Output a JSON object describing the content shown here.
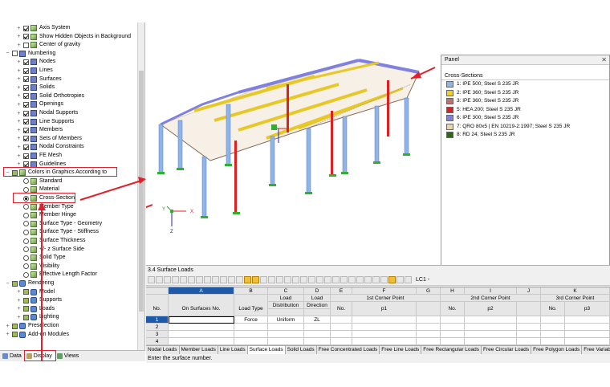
{
  "tree": {
    "items": [
      {
        "label": "Axis System",
        "kind": "check",
        "state": "on",
        "icon": "axis-icon"
      },
      {
        "label": "Show Hidden Objects in Background",
        "kind": "check",
        "state": "on",
        "icon": "hidden-objects-icon"
      },
      {
        "label": "Center of gravity",
        "kind": "check",
        "state": "off",
        "icon": "center-of-gravity-icon"
      },
      {
        "label": "Numbering",
        "kind": "check",
        "state": "off",
        "icon": "numbering-icon"
      },
      {
        "label": "Nodes",
        "kind": "check",
        "state": "on",
        "icon": "numbering-icon"
      },
      {
        "label": "Lines",
        "kind": "check",
        "state": "on",
        "icon": "numbering-icon"
      },
      {
        "label": "Surfaces",
        "kind": "check",
        "state": "on",
        "icon": "numbering-icon"
      },
      {
        "label": "Solids",
        "kind": "check",
        "state": "on",
        "icon": "numbering-icon"
      },
      {
        "label": "Solid Orthotropies",
        "kind": "check",
        "state": "on",
        "icon": "numbering-icon"
      },
      {
        "label": "Openings",
        "kind": "check",
        "state": "on",
        "icon": "numbering-icon"
      },
      {
        "label": "Nodal Supports",
        "kind": "check",
        "state": "on",
        "icon": "numbering-icon"
      },
      {
        "label": "Line Supports",
        "kind": "check",
        "state": "on",
        "icon": "numbering-icon"
      },
      {
        "label": "Members",
        "kind": "check",
        "state": "on",
        "icon": "numbering-icon"
      },
      {
        "label": "Sets of Members",
        "kind": "check",
        "state": "on",
        "icon": "numbering-icon"
      },
      {
        "label": "Nodal Constraints",
        "kind": "check",
        "state": "on",
        "icon": "numbering-icon"
      },
      {
        "label": "FE Mesh",
        "kind": "check",
        "state": "on",
        "icon": "numbering-icon"
      },
      {
        "label": "Guidelines",
        "kind": "check",
        "state": "on",
        "icon": "numbering-icon"
      },
      {
        "label": "Colors in Graphics According to",
        "kind": "check",
        "state": "part",
        "icon": "colors-icon"
      },
      {
        "label": "Standard",
        "kind": "radio",
        "state": "off",
        "icon": "colors-icon"
      },
      {
        "label": "Material",
        "kind": "radio",
        "state": "off",
        "icon": "colors-icon"
      },
      {
        "label": "Cross-Section",
        "kind": "radio",
        "state": "on",
        "icon": "colors-icon"
      },
      {
        "label": "Member Type",
        "kind": "radio",
        "state": "off",
        "icon": "colors-icon"
      },
      {
        "label": "Member Hinge",
        "kind": "radio",
        "state": "off",
        "icon": "colors-icon"
      },
      {
        "label": "Surface Type - Geometry",
        "kind": "radio",
        "state": "off",
        "icon": "colors-icon"
      },
      {
        "label": "Surface Type - Stiffness",
        "kind": "radio",
        "state": "off",
        "icon": "colors-icon"
      },
      {
        "label": "Surface Thickness",
        "kind": "radio",
        "state": "off",
        "icon": "colors-icon"
      },
      {
        "label": "+/- z Surface Side",
        "kind": "radio",
        "state": "off",
        "icon": "colors-icon"
      },
      {
        "label": "Solid Type",
        "kind": "radio",
        "state": "off",
        "icon": "colors-icon"
      },
      {
        "label": "Visibility",
        "kind": "radio",
        "state": "off",
        "icon": "colors-icon"
      },
      {
        "label": "Effective Length Factor",
        "kind": "radio",
        "state": "off",
        "icon": "colors-icon"
      },
      {
        "label": "Rendering",
        "kind": "check",
        "state": "part",
        "icon": "rendering-icon"
      },
      {
        "label": "Model",
        "kind": "check",
        "state": "part",
        "icon": "rendering-icon"
      },
      {
        "label": "Supports",
        "kind": "check",
        "state": "part",
        "icon": "rendering-icon"
      },
      {
        "label": "Loads",
        "kind": "check",
        "state": "part",
        "icon": "rendering-icon"
      },
      {
        "label": "Lighting",
        "kind": "check",
        "state": "part",
        "icon": "rendering-icon"
      },
      {
        "label": "Preselection",
        "kind": "check",
        "state": "part",
        "icon": "preselection-icon"
      },
      {
        "label": "Add-on Modules",
        "kind": "check",
        "state": "part",
        "icon": "addon-icon"
      }
    ]
  },
  "nav_tabs": [
    {
      "label": "Data",
      "icon": "data-icon"
    },
    {
      "label": "Display",
      "icon": "display-icon"
    },
    {
      "label": "Views",
      "icon": "views-icon"
    }
  ],
  "panel": {
    "title": "Panel",
    "subtitle": "Cross-Sections",
    "items": [
      {
        "label": "1: IPE 500; Steel S 235 JR",
        "color": "#8fb4e8"
      },
      {
        "label": "2: IPE 360; Steel S 235 JR",
        "color": "#f0d020"
      },
      {
        "label": "3: IPE 360; Steel S 235 JR",
        "color": "#c07070"
      },
      {
        "label": "5: HEA 200; Steel S 235 JR",
        "color": "#e02020"
      },
      {
        "label": "6: IPE 300; Steel S 235 JR",
        "color": "#8080e0"
      },
      {
        "label": "7: QRO 80x5 | EN 10219-2:1997; Steel S 235 JR",
        "color": "#e8d8a8"
      },
      {
        "label": "8: RD 24; Steel S 235 JR",
        "color": "#2a6a10"
      }
    ]
  },
  "table": {
    "title": "3.4 Surface Loads",
    "lc_label": "LC1 -",
    "col_letters": [
      "A",
      "B",
      "C",
      "D",
      "E",
      "F",
      "G",
      "H",
      "I",
      "J",
      "K"
    ],
    "headers": {
      "no": "No.",
      "on_surfaces": "On Surfaces No.",
      "load_type": "Load Type",
      "load_distribution_1": "Load",
      "load_distribution_2": "Distribution",
      "load_direction_1": "Load",
      "load_direction_2": "Direction",
      "corner1": "1st Corner Point",
      "corner1_no": "No.",
      "corner1_p": "p1",
      "corner2": "2nd Corner Point",
      "corner2_no": "No.",
      "corner2_p": "p2",
      "corner3": "3rd Corner Point",
      "corner3_no": "No.",
      "corner3_p": "p3"
    },
    "rows": [
      {
        "no": "1",
        "on_surfaces": "",
        "load_type": "Force",
        "distribution": "Uniform",
        "direction": "ZL"
      },
      {
        "no": "2",
        "on_surfaces": "",
        "load_type": "",
        "distribution": "",
        "direction": ""
      },
      {
        "no": "3",
        "on_surfaces": "",
        "load_type": "",
        "distribution": "",
        "direction": ""
      },
      {
        "no": "4",
        "on_surfaces": "",
        "load_type": "",
        "distribution": "",
        "direction": ""
      }
    ]
  },
  "sheet_tabs": [
    "Nodal Loads",
    "Member Loads",
    "Line Loads",
    "Surface Loads",
    "Solid Loads",
    "Free Concentrated Loads",
    "Free Line Loads",
    "Free Rectangular Loads",
    "Free Circular Loads",
    "Free Polygon Loads",
    "Free Variable L"
  ],
  "status": "Enter the surface number.",
  "axis": {
    "x": "X",
    "y": "Y",
    "z": "Z"
  }
}
